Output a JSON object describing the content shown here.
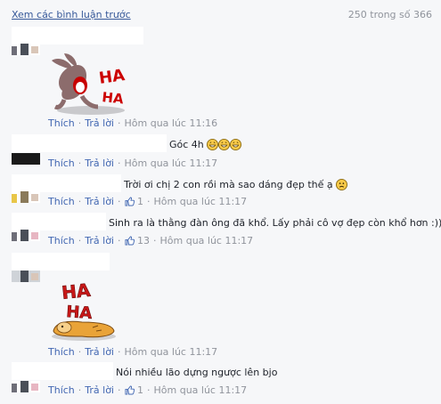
{
  "header": {
    "view_previous": "Xem các bình luận trước",
    "count": "250 trong số 366"
  },
  "actions": {
    "like": "Thích",
    "reply": "Trả lời",
    "sep": "·"
  },
  "comments": [
    {
      "text": "",
      "sticker": "haha-rabbit-sticker",
      "time": "Hôm qua lúc 11:16"
    },
    {
      "text": "Góc 4h",
      "emoji": "grinning-face-emoji ×3",
      "time": "Hôm qua lúc 11:17"
    },
    {
      "text": "Trời ơi chị 2 con rồi mà sao dáng đẹp thế ạ",
      "emoji": "frowning-face-emoji",
      "likes": "1",
      "time": "Hôm qua lúc 11:17"
    },
    {
      "text": "Sinh ra là thằng đàn ông đã khổ. Lấy phải cô vợ đẹp còn khổ hơn :))",
      "likes": "13",
      "time": "Hôm qua lúc 11:17"
    },
    {
      "text": "",
      "sticker": "haha-dog-sticker",
      "time": "Hôm qua lúc 11:17"
    },
    {
      "text": "Nói nhiều lão dựng ngược lên bjo",
      "likes": "1",
      "time": "Hôm qua lúc 11:17"
    }
  ],
  "sticker_text": {
    "ha1": "HA",
    "ha2": "HA"
  }
}
